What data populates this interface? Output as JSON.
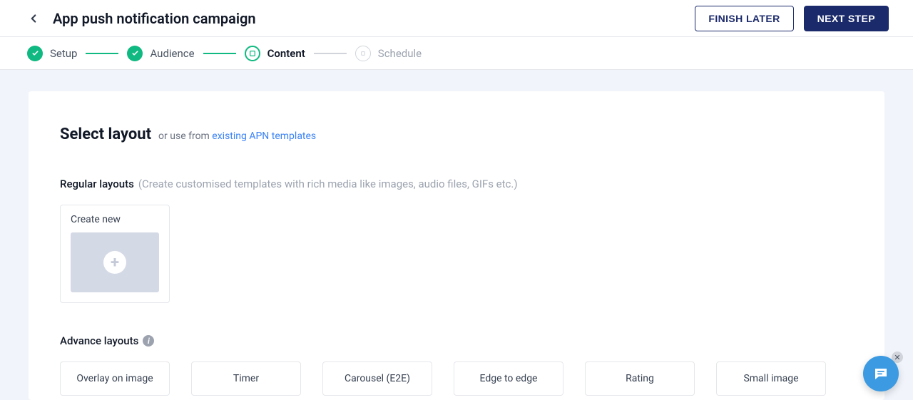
{
  "header": {
    "title": "App push notification campaign",
    "finish_later": "FINISH LATER",
    "next_step": "NEXT STEP"
  },
  "stepper": {
    "steps": [
      {
        "label": "Setup",
        "state": "done"
      },
      {
        "label": "Audience",
        "state": "done"
      },
      {
        "label": "Content",
        "state": "current"
      },
      {
        "label": "Schedule",
        "state": "inactive"
      }
    ]
  },
  "content": {
    "select_layout_title": "Select layout",
    "select_layout_sub": "or use from ",
    "select_layout_link": "existing APN templates",
    "regular": {
      "title": "Regular layouts",
      "desc": "(Create customised templates with rich media like images, audio files, GIFs etc.)",
      "create_new": "Create new"
    },
    "advance": {
      "title": "Advance layouts",
      "cards": [
        {
          "label": "Overlay on image"
        },
        {
          "label": "Timer"
        },
        {
          "label": "Carousel (E2E)"
        },
        {
          "label": "Edge to edge"
        },
        {
          "label": "Rating"
        },
        {
          "label": "Small image"
        }
      ]
    }
  }
}
